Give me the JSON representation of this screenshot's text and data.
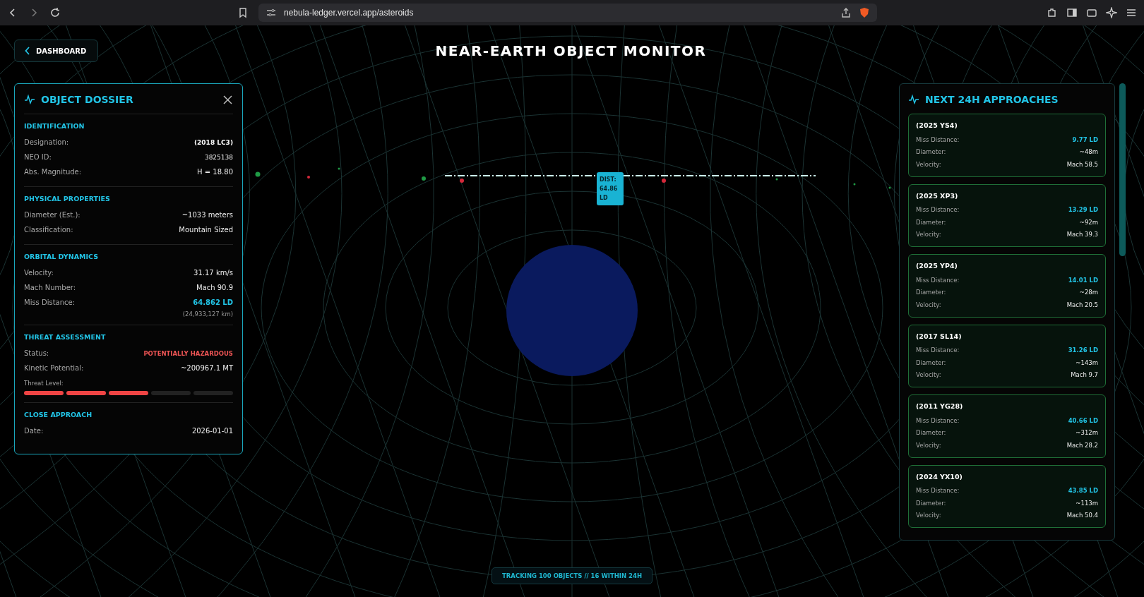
{
  "browser": {
    "url": "nebula-ledger.vercel.app/asteroids"
  },
  "back_button": {
    "label": "DASHBOARD"
  },
  "title": "NEAR-EARTH OBJECT MONITOR",
  "dossier": {
    "title": "OBJECT DOSSIER",
    "sections": [
      {
        "heading": "IDENTIFICATION",
        "rows": [
          {
            "kind": "strong",
            "label": "Designation:",
            "value": "(2018 LC3)"
          },
          {
            "kind": "small",
            "label": "NEO ID:",
            "value": "3825138"
          },
          {
            "kind": "field",
            "label": "Abs. Magnitude:",
            "value": "H = 18.80"
          }
        ]
      },
      {
        "heading": "PHYSICAL PROPERTIES",
        "rows": [
          {
            "kind": "field",
            "label": "Diameter (Est.):",
            "value": "~1033 meters"
          },
          {
            "kind": "field",
            "label": "Classification:",
            "value": "Mountain Sized"
          }
        ]
      },
      {
        "heading": "ORBITAL DYNAMICS",
        "rows": [
          {
            "kind": "field",
            "label": "Velocity:",
            "value": "31.17 km/s"
          },
          {
            "kind": "field",
            "label": "Mach Number:",
            "value": "Mach 90.9"
          },
          {
            "kind": "accent",
            "label": "Miss Distance:",
            "value": "64.862 LD"
          },
          {
            "kind": "note",
            "value": "(24,933,127 km)"
          }
        ]
      },
      {
        "heading": "THREAT ASSESSMENT",
        "rows": [
          {
            "kind": "danger",
            "label": "Status:",
            "value": "POTENTIALLY HAZARDOUS"
          },
          {
            "kind": "field",
            "label": "Kinetic Potential:",
            "value": "~200967.1 MT"
          },
          {
            "kind": "meter",
            "label": "Threat Level:",
            "segments": [
              {
                "on": true
              },
              {
                "on": true
              },
              {
                "on": true
              },
              {
                "on": false
              },
              {
                "on": false
              }
            ]
          }
        ]
      },
      {
        "heading": "CLOSE APPROACH",
        "rows": [
          {
            "kind": "field",
            "label": "Date:",
            "value": "2026-01-01"
          }
        ]
      }
    ]
  },
  "scene": {
    "tooltip": "DIST: 64.86 LD"
  },
  "approaches": {
    "title": "NEXT 24H APPROACHES",
    "items": [
      {
        "name": "(2025 YS4)",
        "rows": [
          {
            "kind": "accent",
            "label": "Miss Distance:",
            "value": "9.77 LD"
          },
          {
            "kind": "field",
            "label": "Diameter:",
            "value": "~48m"
          },
          {
            "kind": "field",
            "label": "Velocity:",
            "value": "Mach 58.5"
          }
        ]
      },
      {
        "name": "(2025 XP3)",
        "rows": [
          {
            "kind": "accent",
            "label": "Miss Distance:",
            "value": "13.29 LD"
          },
          {
            "kind": "field",
            "label": "Diameter:",
            "value": "~92m"
          },
          {
            "kind": "field",
            "label": "Velocity:",
            "value": "Mach 39.3"
          }
        ]
      },
      {
        "name": "(2025 YP4)",
        "rows": [
          {
            "kind": "accent",
            "label": "Miss Distance:",
            "value": "14.01 LD"
          },
          {
            "kind": "field",
            "label": "Diameter:",
            "value": "~28m"
          },
          {
            "kind": "field",
            "label": "Velocity:",
            "value": "Mach 20.5"
          }
        ]
      },
      {
        "name": "(2017 SL14)",
        "rows": [
          {
            "kind": "accent",
            "label": "Miss Distance:",
            "value": "31.26 LD"
          },
          {
            "kind": "field",
            "label": "Diameter:",
            "value": "~143m"
          },
          {
            "kind": "field",
            "label": "Velocity:",
            "value": "Mach 9.7"
          }
        ]
      },
      {
        "name": "(2011 YG28)",
        "rows": [
          {
            "kind": "accent",
            "label": "Miss Distance:",
            "value": "40.66 LD"
          },
          {
            "kind": "field",
            "label": "Diameter:",
            "value": "~312m"
          },
          {
            "kind": "field",
            "label": "Velocity:",
            "value": "Mach 28.2"
          }
        ]
      },
      {
        "name": "(2024 YX10)",
        "rows": [
          {
            "kind": "accent",
            "label": "Miss Distance:",
            "value": "43.85 LD"
          },
          {
            "kind": "field",
            "label": "Diameter:",
            "value": "~113m"
          },
          {
            "kind": "field",
            "label": "Velocity:",
            "value": "Mach 50.4"
          }
        ]
      }
    ]
  },
  "status": "TRACKING 100 OBJECTS // 16 WITHIN 24H"
}
